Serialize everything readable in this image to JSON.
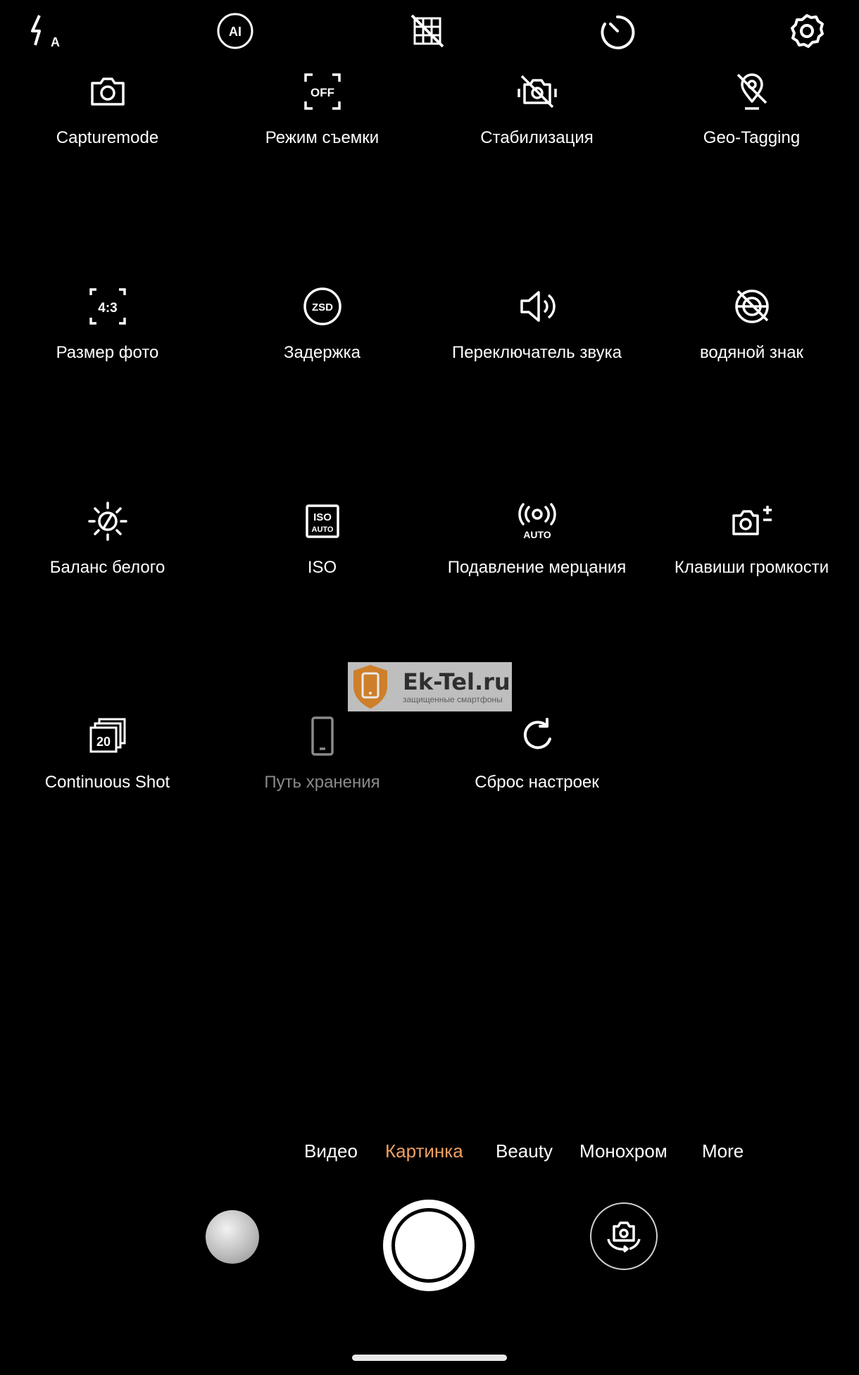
{
  "top_bar": {
    "icons": [
      "flash-auto-icon",
      "ai-icon",
      "grid-off-icon",
      "timer-icon",
      "settings-gear-icon"
    ],
    "flash_letter": "A",
    "ai_label": "AI"
  },
  "settings_grid": {
    "items": [
      {
        "label": "Capturemode",
        "icon": "camera-icon",
        "enabled": true
      },
      {
        "label": "Режим съемки",
        "icon": "off-frame-icon",
        "icon_text": "OFF",
        "enabled": true
      },
      {
        "label": "Стабилизация",
        "icon": "stabilization-off-icon",
        "enabled": true
      },
      {
        "label": "Geo-Tagging",
        "icon": "geo-tag-off-icon",
        "enabled": true
      },
      {
        "label": "Размер фото",
        "icon": "aspect-ratio-icon",
        "icon_text": "4:3",
        "enabled": true
      },
      {
        "label": "Задержка",
        "icon": "zsd-icon",
        "icon_text": "ZSD",
        "enabled": true
      },
      {
        "label": "Переключатель звука",
        "icon": "sound-on-icon",
        "enabled": true
      },
      {
        "label": "водяной знак",
        "icon": "watermark-off-icon",
        "enabled": true
      },
      {
        "label": "Баланс белого",
        "icon": "white-balance-icon",
        "enabled": true
      },
      {
        "label": "ISO",
        "icon": "iso-auto-icon",
        "icon_text": "ISO",
        "icon_subtext": "AUTO",
        "enabled": true
      },
      {
        "label": "Подавление мерцания",
        "icon": "antiflicker-auto-icon",
        "icon_text": "AUTO",
        "enabled": true
      },
      {
        "label": "Клавиши громкости",
        "icon": "volume-keys-camera-icon",
        "enabled": true
      },
      {
        "label": "Continuous Shot",
        "icon": "burst-icon",
        "icon_text": "20",
        "enabled": true
      },
      {
        "label": "Путь хранения",
        "icon": "phone-storage-icon",
        "enabled": false
      },
      {
        "label": "Сброс настроек",
        "icon": "reset-icon",
        "enabled": true
      }
    ]
  },
  "watermark": {
    "title": "Ek-Tel.ru",
    "subtitle": "защищенные смартфоны"
  },
  "modes": {
    "items": [
      "Видео",
      "Картинка",
      "Beauty",
      "Монохром",
      "More"
    ],
    "active": "Картинка",
    "active_color": "#f0a060"
  },
  "bottom_controls": {
    "gallery": "gallery-thumbnail",
    "shutter": "shutter-button",
    "switch": "switch-camera-icon"
  }
}
